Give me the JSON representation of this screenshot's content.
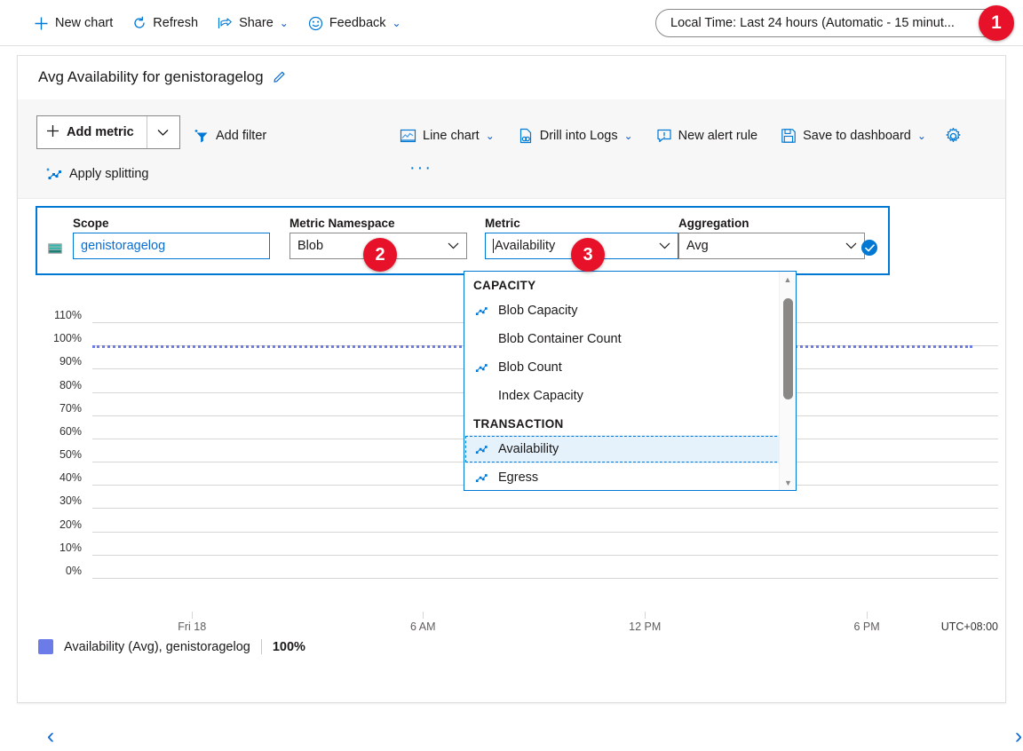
{
  "topbar": {
    "commands": [
      {
        "label": "New chart",
        "icon": "plus-icon"
      },
      {
        "label": "Refresh",
        "icon": "refresh-icon"
      },
      {
        "label": "Share",
        "icon": "share-icon",
        "chevron": "⌄"
      },
      {
        "label": "Feedback",
        "icon": "smiley-icon",
        "chevron": "⌄"
      }
    ],
    "time_picker": "Local Time: Last 24 hours (Automatic - 15 minut...",
    "badge_1": "1"
  },
  "card": {
    "title": "Avg Availability for genistoragelog",
    "edit_icon": "pencil-icon"
  },
  "chart_toolbar": {
    "add_metric": "Add metric",
    "add_filter": "Add filter",
    "apply_splitting": "Apply splitting",
    "chart_type": "Line chart",
    "drill_into_logs": "Drill into Logs",
    "new_alert_rule": "New alert rule",
    "save_to_dashboard": "Save to dashboard",
    "ellipsis": "···",
    "chevron": "⌄"
  },
  "selector": {
    "scope": {
      "label": "Scope",
      "value": "genistoragelog"
    },
    "namespace": {
      "label": "Metric Namespace",
      "value": "Blob",
      "badge": "2"
    },
    "metric": {
      "label": "Metric",
      "value": "Availability",
      "badge": "3"
    },
    "aggregation": {
      "label": "Aggregation",
      "value": "Avg"
    },
    "apply_icon": "checkmark-icon"
  },
  "dropdown": {
    "groups": [
      {
        "header": "CAPACITY",
        "items": [
          {
            "label": "Blob Capacity",
            "has_icon": true,
            "selected": false
          },
          {
            "label": "Blob Container Count",
            "has_icon": false,
            "selected": false
          },
          {
            "label": "Blob Count",
            "has_icon": true,
            "selected": false
          },
          {
            "label": "Index Capacity",
            "has_icon": false,
            "selected": false
          }
        ]
      },
      {
        "header": "TRANSACTION",
        "items": [
          {
            "label": "Availability",
            "has_icon": true,
            "selected": true
          },
          {
            "label": "Egress",
            "has_icon": true,
            "selected": false
          }
        ]
      }
    ],
    "scroll_up": "▲",
    "scroll_down": "▼"
  },
  "chart_data": {
    "type": "line",
    "title": "Avg Availability for genistoragelog",
    "xlabel": "",
    "ylabel": "",
    "ylim": [
      0,
      110
    ],
    "yticks": [
      "0%",
      "10%",
      "20%",
      "30%",
      "40%",
      "50%",
      "60%",
      "70%",
      "80%",
      "90%",
      "100%",
      "110%"
    ],
    "ytick_values": [
      0,
      10,
      20,
      30,
      40,
      50,
      60,
      70,
      80,
      90,
      100,
      110
    ],
    "xticks": [
      "Fri 18",
      "6 AM",
      "12 PM",
      "6 PM"
    ],
    "xtick_positions_pct": [
      11,
      36.5,
      61,
      85.5
    ],
    "timezone": "UTC+08:00",
    "grid": true,
    "legend_position": "bottom-left",
    "series": [
      {
        "name": "Availability (Avg), genistoragelog",
        "color": "#6b7ce8",
        "current_value": "100%",
        "style": "dotted",
        "values": [
          100,
          100,
          100,
          100,
          100,
          100,
          100,
          100,
          100,
          100,
          100,
          100,
          100,
          100,
          100,
          100,
          100,
          100,
          100,
          100,
          100,
          100,
          100,
          100
        ]
      }
    ]
  },
  "legend": {
    "label": "Availability (Avg), genistoragelog",
    "value": "100%"
  },
  "nav": {
    "prev": "‹",
    "next": "›"
  },
  "colors": {
    "accent": "#0078d4",
    "series": "#6b7ce8",
    "badge": "#e8112a"
  }
}
